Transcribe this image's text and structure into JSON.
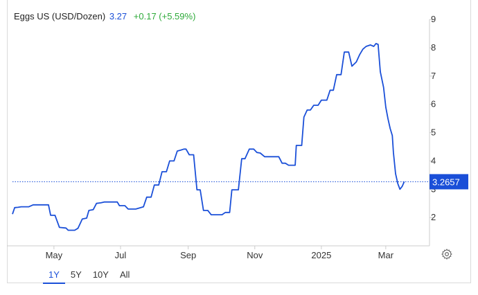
{
  "header": {
    "title": "Eggs US (USD/Dozen)",
    "price": "3.27",
    "change": "+0.17 (+5.59%)"
  },
  "ranges": [
    "1Y",
    "5Y",
    "10Y",
    "All"
  ],
  "active_range": "1Y",
  "colors": {
    "line": "#1a4fd8",
    "change": "#2eaa3a",
    "axis": "#cccccc"
  },
  "icons": {
    "settings": "gear-icon"
  },
  "chart_data": {
    "type": "line",
    "title": "Eggs US (USD/Dozen)",
    "xlabel": "",
    "ylabel": "",
    "ylim": [
      1,
      9.2
    ],
    "y_ticks": [
      2,
      3,
      4,
      5,
      6,
      7,
      8,
      9
    ],
    "x_ticks": [
      {
        "label": "May",
        "x": "2024-05-01"
      },
      {
        "label": "Jul",
        "x": "2024-07-01"
      },
      {
        "label": "Sep",
        "x": "2024-09-01"
      },
      {
        "label": "Nov",
        "x": "2024-11-01"
      },
      {
        "label": "2025",
        "x": "2025-01-01"
      },
      {
        "label": "Mar",
        "x": "2025-03-01"
      }
    ],
    "xlim": [
      "2024-03-24",
      "2025-04-05"
    ],
    "last_value": 3.2657,
    "last_value_label": "3.2657",
    "grid": false,
    "legend": "none",
    "series": [
      {
        "points": [
          [
            "2024-03-24",
            2.12
          ],
          [
            "2024-03-26",
            2.35
          ],
          [
            "2024-03-29",
            2.36
          ],
          [
            "2024-04-01",
            2.38
          ],
          [
            "2024-04-08",
            2.38
          ],
          [
            "2024-04-12",
            2.45
          ],
          [
            "2024-04-19",
            2.45
          ],
          [
            "2024-04-22",
            2.45
          ],
          [
            "2024-04-26",
            2.45
          ],
          [
            "2024-04-28",
            2.08
          ],
          [
            "2024-05-02",
            2.08
          ],
          [
            "2024-05-06",
            1.65
          ],
          [
            "2024-05-12",
            1.63
          ],
          [
            "2024-05-14",
            1.55
          ],
          [
            "2024-05-20",
            1.55
          ],
          [
            "2024-05-23",
            1.62
          ],
          [
            "2024-05-27",
            1.95
          ],
          [
            "2024-05-31",
            1.98
          ],
          [
            "2024-06-02",
            2.25
          ],
          [
            "2024-06-06",
            2.28
          ],
          [
            "2024-06-09",
            2.5
          ],
          [
            "2024-06-13",
            2.52
          ],
          [
            "2024-06-16",
            2.55
          ],
          [
            "2024-06-23",
            2.55
          ],
          [
            "2024-06-28",
            2.55
          ],
          [
            "2024-06-30",
            2.42
          ],
          [
            "2024-07-05",
            2.42
          ],
          [
            "2024-07-08",
            2.3
          ],
          [
            "2024-07-15",
            2.3
          ],
          [
            "2024-07-22",
            2.38
          ],
          [
            "2024-07-25",
            2.72
          ],
          [
            "2024-07-29",
            2.72
          ],
          [
            "2024-08-01",
            3.15
          ],
          [
            "2024-08-05",
            3.15
          ],
          [
            "2024-08-08",
            3.62
          ],
          [
            "2024-08-12",
            3.62
          ],
          [
            "2024-08-15",
            4.0
          ],
          [
            "2024-08-19",
            4.0
          ],
          [
            "2024-08-22",
            4.35
          ],
          [
            "2024-08-25",
            4.38
          ],
          [
            "2024-08-28",
            4.42
          ],
          [
            "2024-08-30",
            4.42
          ],
          [
            "2024-09-02",
            4.22
          ],
          [
            "2024-09-06",
            4.22
          ],
          [
            "2024-09-09",
            2.98
          ],
          [
            "2024-09-12",
            2.98
          ],
          [
            "2024-09-15",
            2.25
          ],
          [
            "2024-09-19",
            2.25
          ],
          [
            "2024-09-22",
            2.1
          ],
          [
            "2024-09-26",
            2.1
          ],
          [
            "2024-10-02",
            2.1
          ],
          [
            "2024-10-05",
            2.18
          ],
          [
            "2024-10-09",
            2.18
          ],
          [
            "2024-10-11",
            2.98
          ],
          [
            "2024-10-17",
            2.98
          ],
          [
            "2024-10-20",
            4.08
          ],
          [
            "2024-10-23",
            4.08
          ],
          [
            "2024-10-27",
            4.42
          ],
          [
            "2024-10-31",
            4.42
          ],
          [
            "2024-11-03",
            4.3
          ],
          [
            "2024-11-06",
            4.28
          ],
          [
            "2024-11-10",
            4.15
          ],
          [
            "2024-11-16",
            4.15
          ],
          [
            "2024-11-23",
            4.15
          ],
          [
            "2024-11-26",
            3.92
          ],
          [
            "2024-11-29",
            3.92
          ],
          [
            "2024-12-02",
            3.85
          ],
          [
            "2024-12-08",
            3.85
          ],
          [
            "2024-12-09",
            4.55
          ],
          [
            "2024-12-14",
            4.55
          ],
          [
            "2024-12-16",
            5.55
          ],
          [
            "2024-12-19",
            5.8
          ],
          [
            "2024-12-22",
            5.8
          ],
          [
            "2024-12-25",
            5.97
          ],
          [
            "2024-12-29",
            5.97
          ],
          [
            "2025-01-01",
            6.15
          ],
          [
            "2025-01-06",
            6.15
          ],
          [
            "2025-01-09",
            6.5
          ],
          [
            "2025-01-12",
            6.5
          ],
          [
            "2025-01-15",
            7.05
          ],
          [
            "2025-01-19",
            7.05
          ],
          [
            "2025-01-22",
            7.85
          ],
          [
            "2025-01-26",
            7.85
          ],
          [
            "2025-01-29",
            7.35
          ],
          [
            "2025-02-02",
            7.5
          ],
          [
            "2025-02-05",
            7.75
          ],
          [
            "2025-02-08",
            7.95
          ],
          [
            "2025-02-11",
            8.05
          ],
          [
            "2025-02-15",
            8.1
          ],
          [
            "2025-02-18",
            8.05
          ],
          [
            "2025-02-20",
            8.15
          ],
          [
            "2025-02-22",
            8.12
          ],
          [
            "2025-02-24",
            7.15
          ],
          [
            "2025-02-27",
            6.6
          ],
          [
            "2025-03-01",
            5.9
          ],
          [
            "2025-03-03",
            5.5
          ],
          [
            "2025-03-05",
            5.15
          ],
          [
            "2025-03-07",
            4.9
          ],
          [
            "2025-03-08",
            4.3
          ],
          [
            "2025-03-10",
            3.55
          ],
          [
            "2025-03-12",
            3.2
          ],
          [
            "2025-03-14",
            3.0
          ],
          [
            "2025-03-16",
            3.1
          ],
          [
            "2025-03-18",
            3.27
          ]
        ]
      }
    ]
  }
}
